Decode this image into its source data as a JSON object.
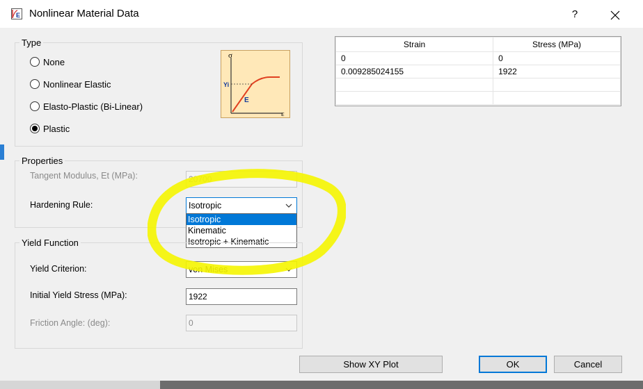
{
  "window": {
    "title": "Nonlinear Material Data",
    "help": "?",
    "icon": "E"
  },
  "type_group": {
    "legend": "Type",
    "options": [
      {
        "label": "None",
        "checked": false
      },
      {
        "label": "Nonlinear Elastic",
        "checked": false
      },
      {
        "label": "Elasto-Plastic (Bi-Linear)",
        "checked": false
      },
      {
        "label": "Plastic",
        "checked": true
      }
    ],
    "diagram": {
      "y_axis": "σ",
      "x_axis": "ε",
      "yield_label": "Yi",
      "slope_label": "E"
    }
  },
  "properties": {
    "legend": "Properties",
    "tangent_label": "Tangent Modulus, Et (MPa):",
    "tangent_value": "20700",
    "hardening_label": "Hardening Rule:",
    "hardening_value": "Isotropic",
    "hardening_options": [
      "Isotropic",
      "Kinematic",
      "Isotropic + Kinematic"
    ]
  },
  "yield_function": {
    "legend": "Yield Function",
    "criterion_label": "Yield Criterion:",
    "criterion_value": "von Mises",
    "initial_label": "Initial Yield Stress (MPa):",
    "initial_value": "1922",
    "friction_label": "Friction Angle: (deg):",
    "friction_value": "0"
  },
  "table": {
    "headers": [
      "Strain",
      "Stress (MPa)"
    ],
    "rows": [
      [
        "0",
        "0"
      ],
      [
        "0.009285024155",
        "1922"
      ],
      [
        "",
        ""
      ],
      [
        "",
        ""
      ]
    ]
  },
  "buttons": {
    "plot": "Show XY Plot",
    "ok": "OK",
    "cancel": "Cancel"
  },
  "colors": {
    "highlight": "#f5f500",
    "accent": "#0078d7"
  }
}
